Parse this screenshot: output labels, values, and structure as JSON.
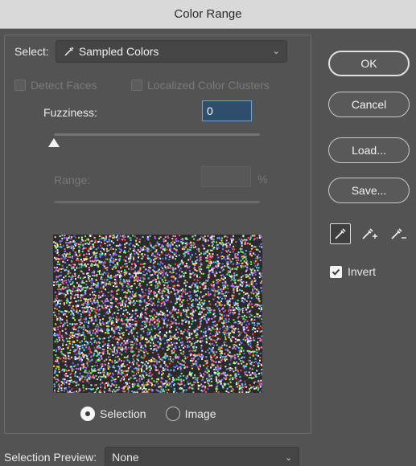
{
  "window": {
    "title": "Color Range"
  },
  "select": {
    "label": "Select:",
    "value": "Sampled Colors"
  },
  "options": {
    "detect_faces": "Detect Faces",
    "localized_clusters": "Localized Color Clusters"
  },
  "fuzziness": {
    "label": "Fuzziness:",
    "value": "0",
    "slider_fraction": 0
  },
  "range": {
    "label": "Range:",
    "unit": "%"
  },
  "preview_mode": {
    "selection": "Selection",
    "image": "Image",
    "selected": "selection"
  },
  "selection_preview": {
    "label": "Selection Preview:",
    "value": "None"
  },
  "buttons": {
    "ok": "OK",
    "cancel": "Cancel",
    "load": "Load...",
    "save": "Save..."
  },
  "eyedroppers": [
    "eyedropper-icon",
    "eyedropper-plus-icon",
    "eyedropper-minus-icon"
  ],
  "invert": {
    "label": "Invert",
    "checked": true
  },
  "colors": {
    "background": "#535353",
    "titlebar": "#d9d9d9",
    "field_focus": "#6ea3da"
  }
}
